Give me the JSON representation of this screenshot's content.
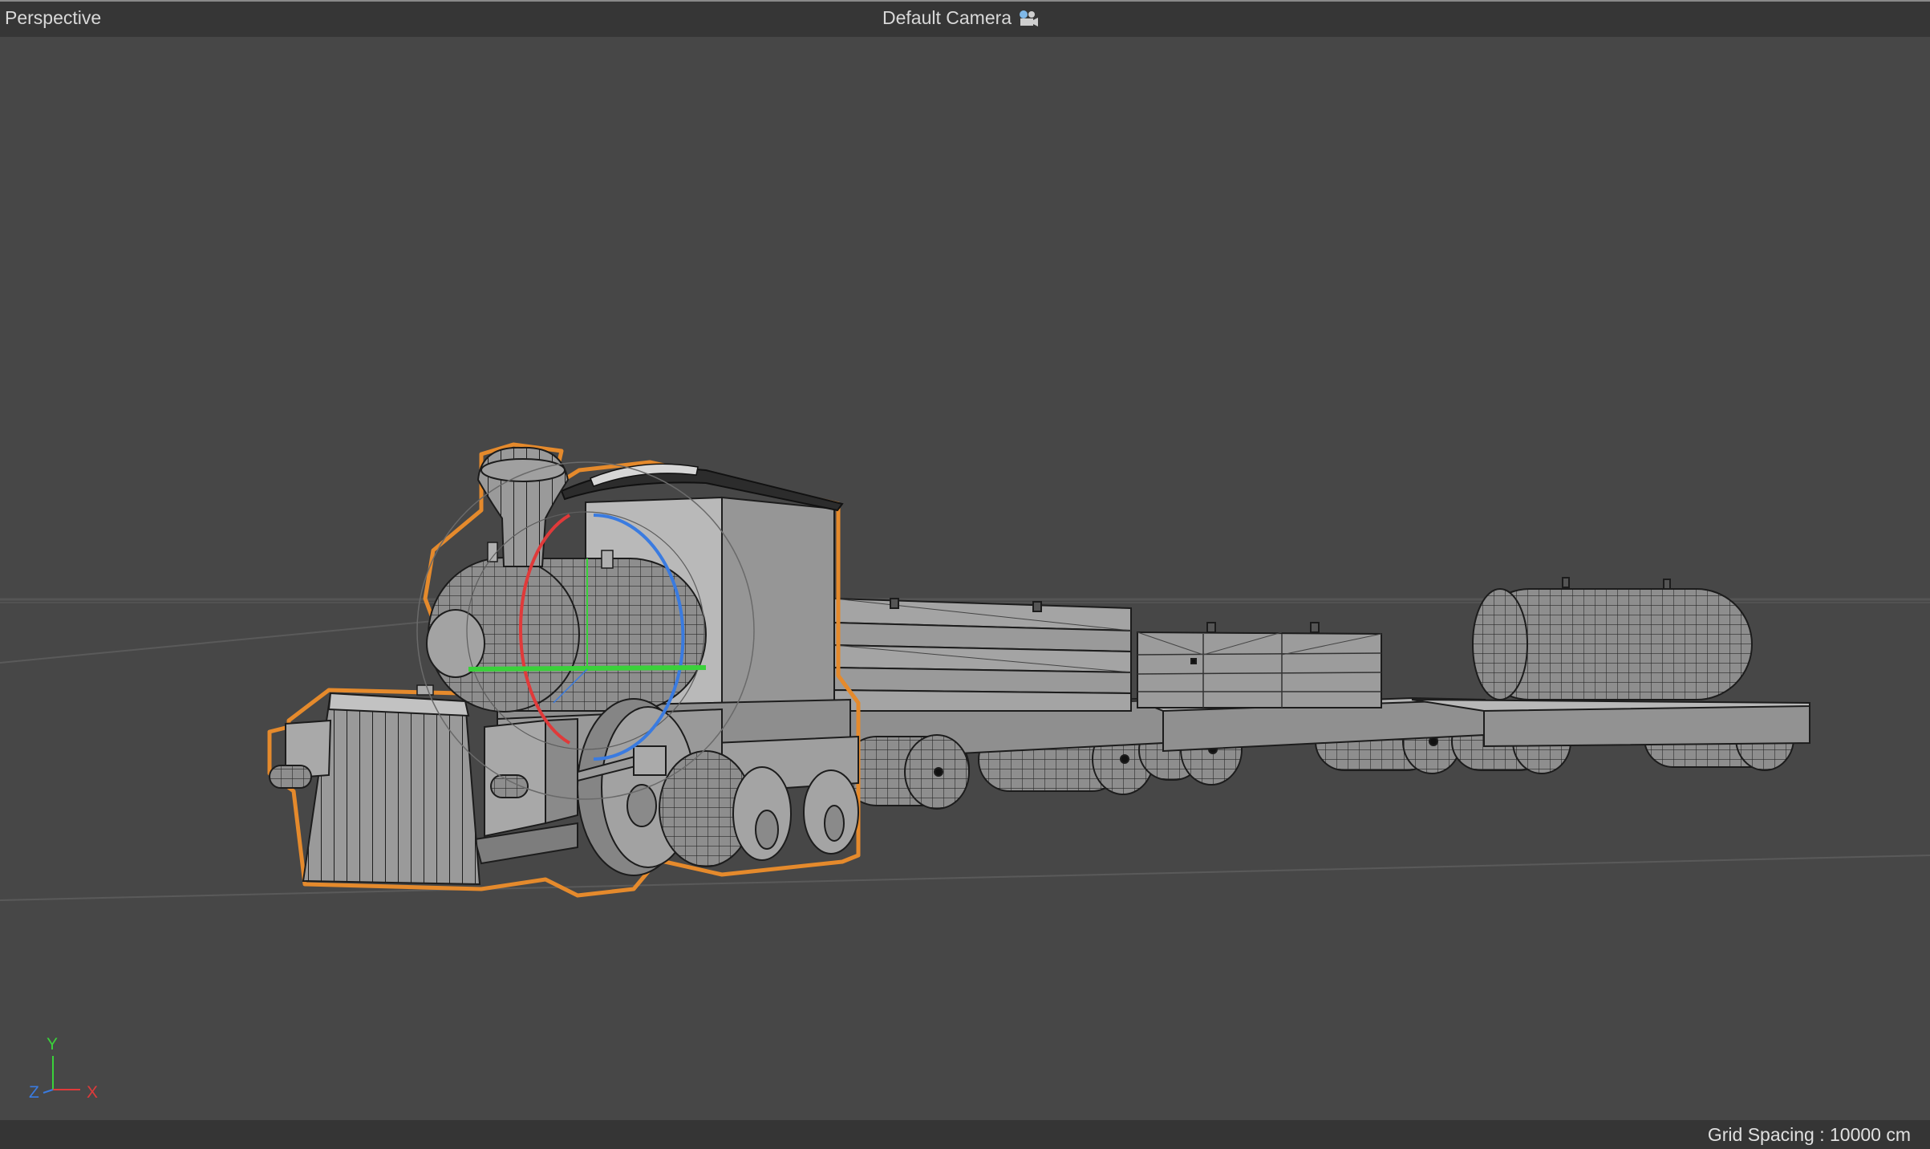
{
  "viewport": {
    "view_name": "Perspective",
    "camera_name": "Default Camera",
    "grid_spacing": "Grid Spacing : 10000 cm"
  },
  "axes": {
    "y": "Y",
    "z": "Z",
    "x": "X"
  },
  "colors": {
    "background": "#474747",
    "selection_outline": "#e58a2c",
    "gizmo_x": "#e03a3a",
    "gizmo_y": "#3ad13a",
    "gizmo_z": "#3a7be0"
  },
  "icons": {
    "camera": "camera-icon"
  }
}
